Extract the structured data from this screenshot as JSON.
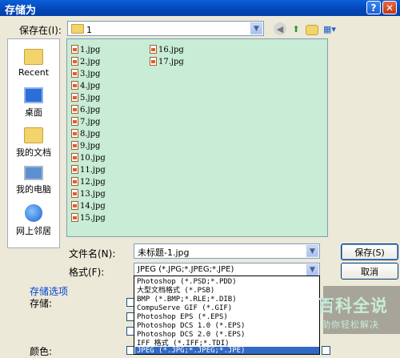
{
  "window": {
    "title": "存储为",
    "help_label": "?",
    "close_label": "✕"
  },
  "save_in": {
    "label": "保存在(I):",
    "value": "1"
  },
  "toolbar": {
    "back_icon": "back-icon",
    "up_icon": "up-folder-icon",
    "new_folder_icon": "new-folder-icon",
    "views_icon": "views-menu-icon"
  },
  "places": [
    {
      "label": "Recent",
      "icon": "recent-icon"
    },
    {
      "label": "桌面",
      "icon": "desktop-icon"
    },
    {
      "label": "我的文档",
      "icon": "my-documents-icon"
    },
    {
      "label": "我的电脑",
      "icon": "my-computer-icon"
    },
    {
      "label": "网上邻居",
      "icon": "network-icon"
    }
  ],
  "files": [
    "1.jpg",
    "2.jpg",
    "3.jpg",
    "4.jpg",
    "5.jpg",
    "6.jpg",
    "7.jpg",
    "8.jpg",
    "9.jpg",
    "10.jpg",
    "11.jpg",
    "12.jpg",
    "13.jpg",
    "14.jpg",
    "15.jpg",
    "16.jpg",
    "17.jpg"
  ],
  "filename": {
    "label": "文件名(N):",
    "value": "未标题-1.jpg"
  },
  "format": {
    "label": "格式(F):",
    "value": "JPEG (*.JPG;*.JPEG;*.JPE)",
    "options": [
      "Photoshop (*.PSD;*.PDD)",
      "大型文档格式 (*.PSB)",
      "BMP (*.BMP;*.RLE;*.DIB)",
      "CompuServe GIF (*.GIF)",
      "Photoshop EPS (*.EPS)",
      "Photoshop DCS 1.0 (*.EPS)",
      "Photoshop DCS 2.0 (*.EPS)",
      "IFF 格式 (*.IFF;*.TDI)",
      "JPEG (*.JPG;*.JPEG;*.JPE)"
    ],
    "selected_index": 8
  },
  "buttons": {
    "save": "保存(S)",
    "cancel": "取消"
  },
  "save_options": {
    "title": "存储选项",
    "store_label": "存储:",
    "color_label": "颜色:"
  },
  "watermark": {
    "logo": "百科全说",
    "sub": "助你轻松解决"
  }
}
